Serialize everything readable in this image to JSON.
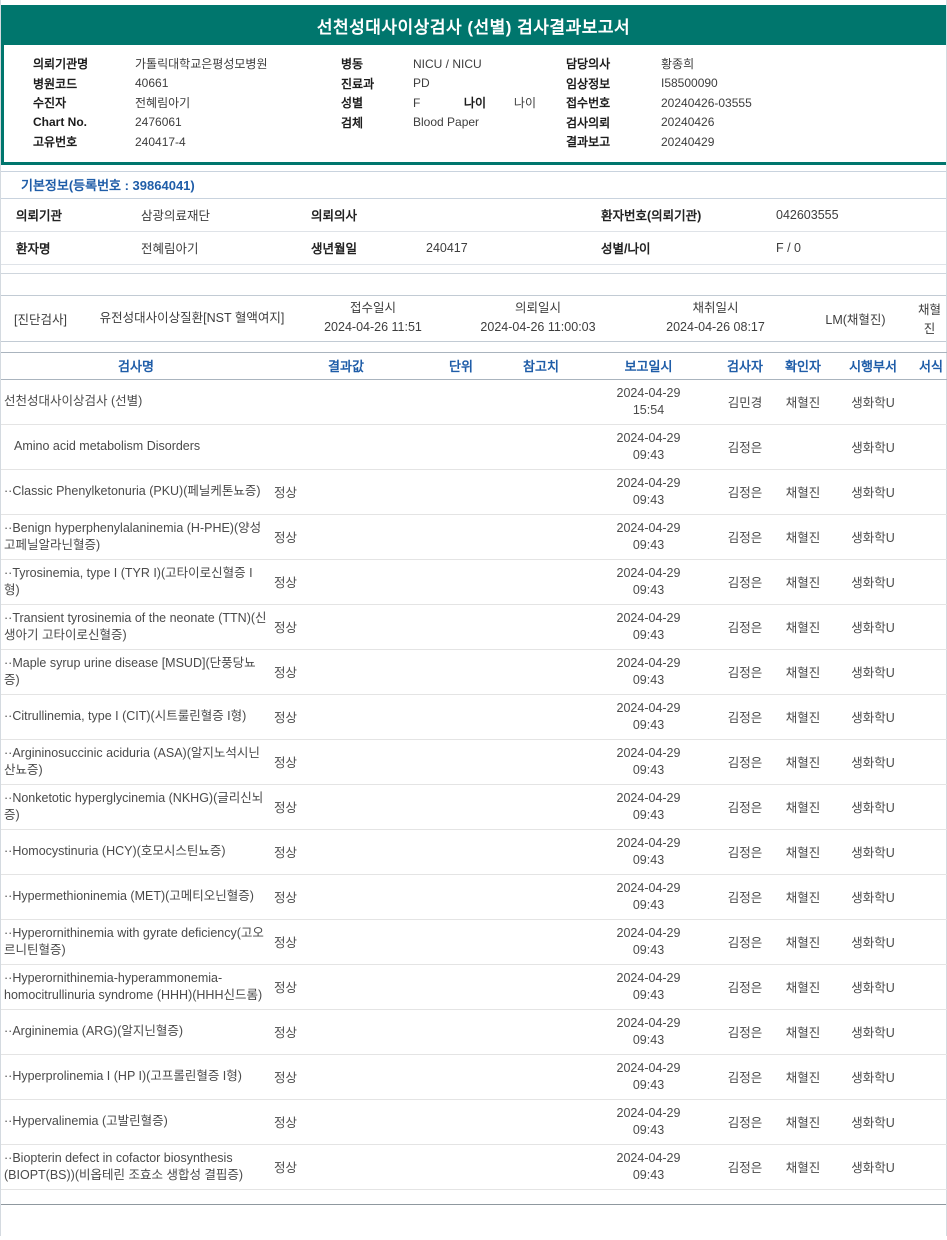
{
  "colors": {
    "teal": "#00766d",
    "blue": "#1f5da8"
  },
  "title": "선천성대사이상검사 (선별) 검사결과보고서",
  "header": {
    "left": [
      {
        "label": "의뢰기관명",
        "value": "가톨릭대학교은평성모병원"
      },
      {
        "label": "병원코드",
        "value": "40661"
      },
      {
        "label": "수진자",
        "value": "전혜림아기"
      },
      {
        "label": "Chart No.",
        "value": "2476061"
      },
      {
        "label": "고유번호",
        "value": "240417-4"
      }
    ],
    "middle": [
      {
        "label": "병동",
        "value": "NICU / NICU"
      },
      {
        "label": "진료과",
        "value": "PD"
      },
      {
        "label": "성별",
        "value": "F",
        "label2": "나이",
        "value2": "나이"
      },
      {
        "label": "검체",
        "value": "Blood Paper"
      }
    ],
    "right": [
      {
        "label": "담당의사",
        "value": "황종희"
      },
      {
        "label": "임상정보",
        "value": "I58500090"
      },
      {
        "label": "접수번호",
        "value": "20240426-03555"
      },
      {
        "label": "검사의뢰",
        "value": "20240426"
      },
      {
        "label": "결과보고",
        "value": "20240429"
      }
    ]
  },
  "basic_info": {
    "section_title": "기본정보(등록번호 : 39864041)",
    "rows": [
      [
        {
          "label": "의뢰기관",
          "value": "삼광의료재단"
        },
        {
          "label": "의뢰의사",
          "value": ""
        },
        {
          "label": "환자번호(의뢰기관)",
          "value": "042603555"
        }
      ],
      [
        {
          "label": "환자명",
          "value": "전혜림아기"
        },
        {
          "label": "생년월일",
          "value": "240417"
        },
        {
          "label": "성별/나이",
          "value": "F / 0"
        }
      ]
    ]
  },
  "diagnostic": {
    "tag": "[진단검사]",
    "test_group": "유전성대사이상질환[NST 혈액여지]",
    "columns": [
      {
        "label": "접수일시",
        "value": "2024-04-26 11:51"
      },
      {
        "label": "의뢰일시",
        "value": "2024-04-26 11:00:03"
      },
      {
        "label": "채취일시",
        "value": "2024-04-26 08:17"
      }
    ],
    "collector": "LM(채혈진)",
    "collector_confirm": "채혈진"
  },
  "results": {
    "headers": [
      "검사명",
      "결과값",
      "단위",
      "참고치",
      "보고일시",
      "검사자",
      "확인자",
      "시행부서",
      "서식"
    ],
    "rows": [
      {
        "name": "선천성대사이상검사 (선별)",
        "result": "",
        "unit": "",
        "ref": "",
        "reported": "2024-04-29 15:54",
        "tester": "김민경",
        "confirmer": "채혈진",
        "dept": "생화학U",
        "form": "",
        "indent": false
      },
      {
        "name": "Amino acid metabolism Disorders",
        "result": "",
        "unit": "",
        "ref": "",
        "reported": "2024-04-29 09:43",
        "tester": "김정은",
        "confirmer": "",
        "dept": "생화학U",
        "form": "",
        "indent": true
      },
      {
        "name": "··Classic Phenylketonuria (PKU)(페닐케톤뇨증)",
        "result": "정상",
        "unit": "",
        "ref": "",
        "reported": "2024-04-29 09:43",
        "tester": "김정은",
        "confirmer": "채혈진",
        "dept": "생화학U",
        "form": "",
        "indent": false
      },
      {
        "name": "··Benign hyperphenylalaninemia (H-PHE)(양성 고페닐알라닌혈증)",
        "result": "정상",
        "unit": "",
        "ref": "",
        "reported": "2024-04-29 09:43",
        "tester": "김정은",
        "confirmer": "채혈진",
        "dept": "생화학U",
        "form": "",
        "indent": false
      },
      {
        "name": "··Tyrosinemia, type I (TYR I)(고타이로신혈증 I형)",
        "result": "정상",
        "unit": "",
        "ref": "",
        "reported": "2024-04-29 09:43",
        "tester": "김정은",
        "confirmer": "채혈진",
        "dept": "생화학U",
        "form": "",
        "indent": false
      },
      {
        "name": "··Transient tyrosinemia of the neonate (TTN)(신생아기 고타이로신혈증)",
        "result": "정상",
        "unit": "",
        "ref": "",
        "reported": "2024-04-29 09:43",
        "tester": "김정은",
        "confirmer": "채혈진",
        "dept": "생화학U",
        "form": "",
        "indent": false
      },
      {
        "name": "··Maple syrup urine disease [MSUD](단풍당뇨증)",
        "result": "정상",
        "unit": "",
        "ref": "",
        "reported": "2024-04-29 09:43",
        "tester": "김정은",
        "confirmer": "채혈진",
        "dept": "생화학U",
        "form": "",
        "indent": false
      },
      {
        "name": "··Citrullinemia, type I (CIT)(시트룰린혈증 I형)",
        "result": "정상",
        "unit": "",
        "ref": "",
        "reported": "2024-04-29 09:43",
        "tester": "김정은",
        "confirmer": "채혈진",
        "dept": "생화학U",
        "form": "",
        "indent": false
      },
      {
        "name": "··Argininosuccinic aciduria (ASA)(알지노석시닌산뇨증)",
        "result": "정상",
        "unit": "",
        "ref": "",
        "reported": "2024-04-29 09:43",
        "tester": "김정은",
        "confirmer": "채혈진",
        "dept": "생화학U",
        "form": "",
        "indent": false
      },
      {
        "name": "··Nonketotic hyperglycinemia (NKHG)(글리신뇌증)",
        "result": "정상",
        "unit": "",
        "ref": "",
        "reported": "2024-04-29 09:43",
        "tester": "김정은",
        "confirmer": "채혈진",
        "dept": "생화학U",
        "form": "",
        "indent": false
      },
      {
        "name": "··Homocystinuria (HCY)(호모시스틴뇨증)",
        "result": "정상",
        "unit": "",
        "ref": "",
        "reported": "2024-04-29 09:43",
        "tester": "김정은",
        "confirmer": "채혈진",
        "dept": "생화학U",
        "form": "",
        "indent": false
      },
      {
        "name": "··Hypermethioninemia (MET)(고메티오닌혈증)",
        "result": "정상",
        "unit": "",
        "ref": "",
        "reported": "2024-04-29 09:43",
        "tester": "김정은",
        "confirmer": "채혈진",
        "dept": "생화학U",
        "form": "",
        "indent": false
      },
      {
        "name": "··Hyperornithinemia with gyrate deficiency(고오르니틴혈증)",
        "result": "정상",
        "unit": "",
        "ref": "",
        "reported": "2024-04-29 09:43",
        "tester": "김정은",
        "confirmer": "채혈진",
        "dept": "생화학U",
        "form": "",
        "indent": false
      },
      {
        "name": "··Hyperornithinemia-hyperammonemia-homocitrullinuria syndrome (HHH)(HHH신드롬)",
        "result": "정상",
        "unit": "",
        "ref": "",
        "reported": "2024-04-29 09:43",
        "tester": "김정은",
        "confirmer": "채혈진",
        "dept": "생화학U",
        "form": "",
        "indent": false
      },
      {
        "name": "··Argininemia (ARG)(알지닌혈증)",
        "result": "정상",
        "unit": "",
        "ref": "",
        "reported": "2024-04-29 09:43",
        "tester": "김정은",
        "confirmer": "채혈진",
        "dept": "생화학U",
        "form": "",
        "indent": false
      },
      {
        "name": "··Hyperprolinemia I (HP I)(고프롤린혈증 I형)",
        "result": "정상",
        "unit": "",
        "ref": "",
        "reported": "2024-04-29 09:43",
        "tester": "김정은",
        "confirmer": "채혈진",
        "dept": "생화학U",
        "form": "",
        "indent": false
      },
      {
        "name": "··Hypervalinemia (고발린혈증)",
        "result": "정상",
        "unit": "",
        "ref": "",
        "reported": "2024-04-29 09:43",
        "tester": "김정은",
        "confirmer": "채혈진",
        "dept": "생화학U",
        "form": "",
        "indent": false
      },
      {
        "name": "··Biopterin defect in cofactor biosynthesis (BIOPT(BS))(비옵테린 조효소 생합성 결핍증)",
        "result": "정상",
        "unit": "",
        "ref": "",
        "reported": "2024-04-29 09:43",
        "tester": "김정은",
        "confirmer": "채혈진",
        "dept": "생화학U",
        "form": "",
        "indent": false
      }
    ]
  }
}
